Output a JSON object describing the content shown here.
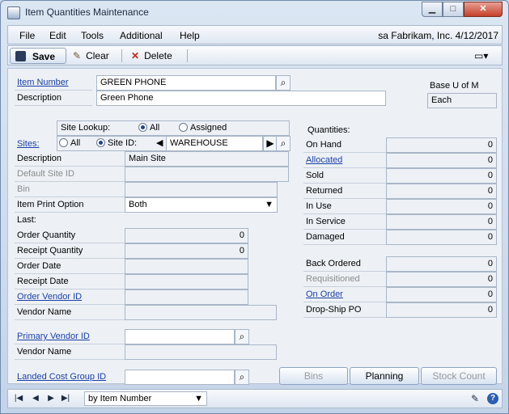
{
  "window": {
    "title": "Item Quantities Maintenance"
  },
  "menu": {
    "items": [
      "File",
      "Edit",
      "Tools",
      "Additional",
      "Help"
    ],
    "context": "sa  Fabrikam, Inc.  4/12/2017"
  },
  "toolbar": {
    "save": "Save",
    "clear": "Clear",
    "delete": "Delete"
  },
  "item": {
    "number_label": "Item Number",
    "number_value": "GREEN PHONE",
    "description_label": "Description",
    "description_value": "Green Phone",
    "base_uom_label": "Base U of M",
    "base_uom_value": "Each"
  },
  "sites": {
    "label": "Sites:",
    "lookup_label": "Site Lookup:",
    "lookup_all": "All",
    "lookup_assigned": "Assigned",
    "all": "All",
    "site_id_label": "Site ID:",
    "site_id_value": "WAREHOUSE",
    "description_label": "Description",
    "description_value": "Main Site",
    "default_site_label": "Default Site ID",
    "bin_label": "Bin",
    "print_option_label": "Item Print Option",
    "print_option_value": "Both"
  },
  "last": {
    "label": "Last:",
    "order_qty_label": "Order Quantity",
    "order_qty_value": "0",
    "receipt_qty_label": "Receipt Quantity",
    "receipt_qty_value": "0",
    "order_date_label": "Order Date",
    "receipt_date_label": "Receipt Date",
    "order_vendor_label": "Order Vendor ID",
    "vendor_name_label": "Vendor Name"
  },
  "primary": {
    "vendor_label": "Primary Vendor ID",
    "vendor_name_label": "Vendor Name"
  },
  "landed": {
    "label": "Landed Cost Group ID"
  },
  "quantities": {
    "label": "Quantities:",
    "rows": [
      {
        "label": "On Hand",
        "value": "0"
      },
      {
        "label": "Allocated",
        "value": "0"
      },
      {
        "label": "Sold",
        "value": "0"
      },
      {
        "label": "Returned",
        "value": "0"
      },
      {
        "label": "In Use",
        "value": "0"
      },
      {
        "label": "In Service",
        "value": "0"
      },
      {
        "label": "Damaged",
        "value": "0"
      }
    ],
    "rows2": [
      {
        "label": "Back Ordered",
        "value": "0"
      },
      {
        "label": "Requisitioned",
        "value": "0"
      },
      {
        "label": "On Order",
        "value": "0"
      },
      {
        "label": "Drop-Ship PO",
        "value": "0"
      }
    ]
  },
  "buttons": {
    "bins": "Bins",
    "planning": "Planning",
    "stock_count": "Stock Count"
  },
  "status": {
    "sort": "by Item Number"
  }
}
